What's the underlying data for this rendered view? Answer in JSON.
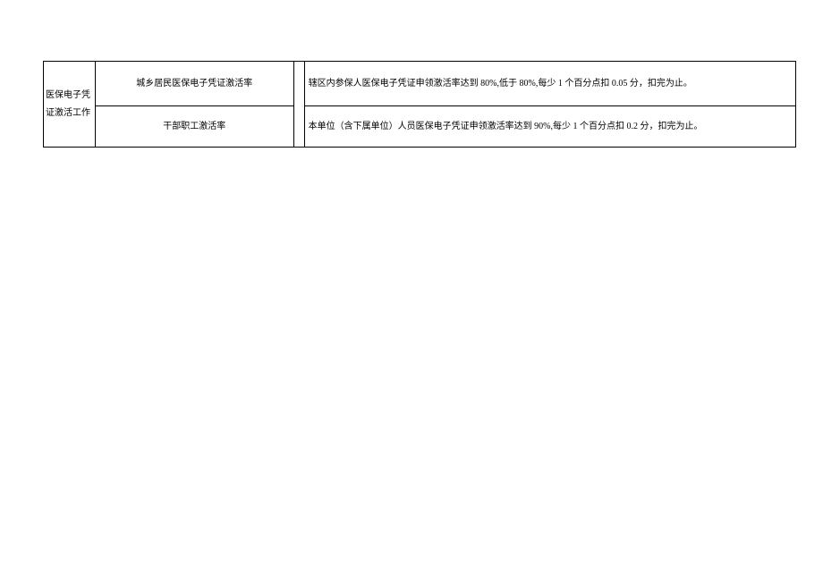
{
  "table": {
    "category": "医保电子凭证激活工作",
    "rows": [
      {
        "indicator": "城乡居民医保电子凭证激活率",
        "description": "辖区内参保人医保电子凭证申领激活率达到 80%,低于 80%,每少 1 个百分点扣 0.05 分，扣完为止。"
      },
      {
        "indicator": "干部职工激活率",
        "description": "本单位（含下属单位）人员医保电子凭证申领激活率达到 90%,每少 1 个百分点扣 0.2 分，扣完为止。"
      }
    ]
  }
}
